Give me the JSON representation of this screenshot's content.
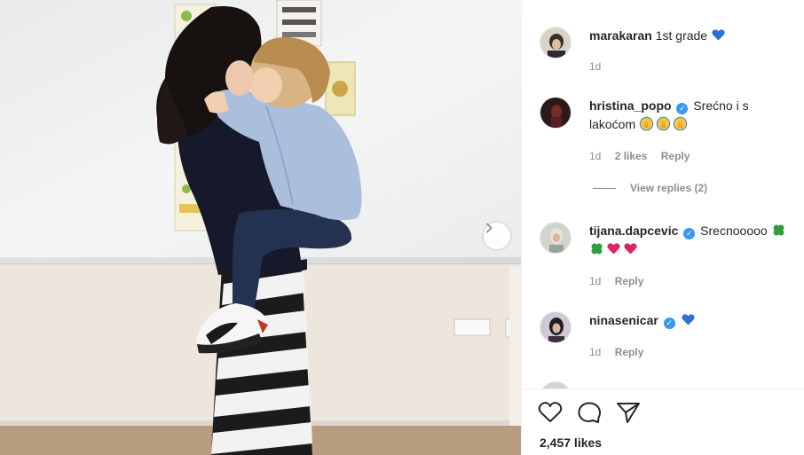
{
  "post": {
    "next_button_icon": "chevron-right-icon",
    "likes": "2,457 likes"
  },
  "comments": [
    {
      "username": "marakaran",
      "verified": false,
      "text": "1st grade",
      "emoji": [
        "blue-heart"
      ],
      "time": "1d",
      "likes": "",
      "reply": ""
    },
    {
      "username": "hristina_popo",
      "verified": true,
      "text": "Srećno i s lakoćom",
      "emoji": [
        "pray-hands",
        "pray-hands",
        "pray-hands"
      ],
      "time": "1d",
      "likes": "2 likes",
      "reply": "Reply",
      "view_replies": "View replies (2)"
    },
    {
      "username": "tijana.dapcevic",
      "verified": true,
      "text": "Srecnooooo",
      "emoji": [
        "four-leaf-clover",
        "four-leaf-clover",
        "red-heart",
        "red-heart"
      ],
      "time": "1d",
      "likes": "",
      "reply": "Reply"
    },
    {
      "username": "ninasenicar",
      "verified": true,
      "text": "",
      "emoji": [
        "blue-heart"
      ],
      "time": "1d",
      "likes": "",
      "reply": "Reply"
    }
  ],
  "actions": {
    "like_icon": "heart-icon",
    "comment_icon": "comment-icon",
    "share_icon": "share-icon"
  },
  "colors": {
    "verified": "#3897f0",
    "blue_heart": "#2f6fd6",
    "red_heart": "#e0245e",
    "clover": "#2e9c3f"
  }
}
